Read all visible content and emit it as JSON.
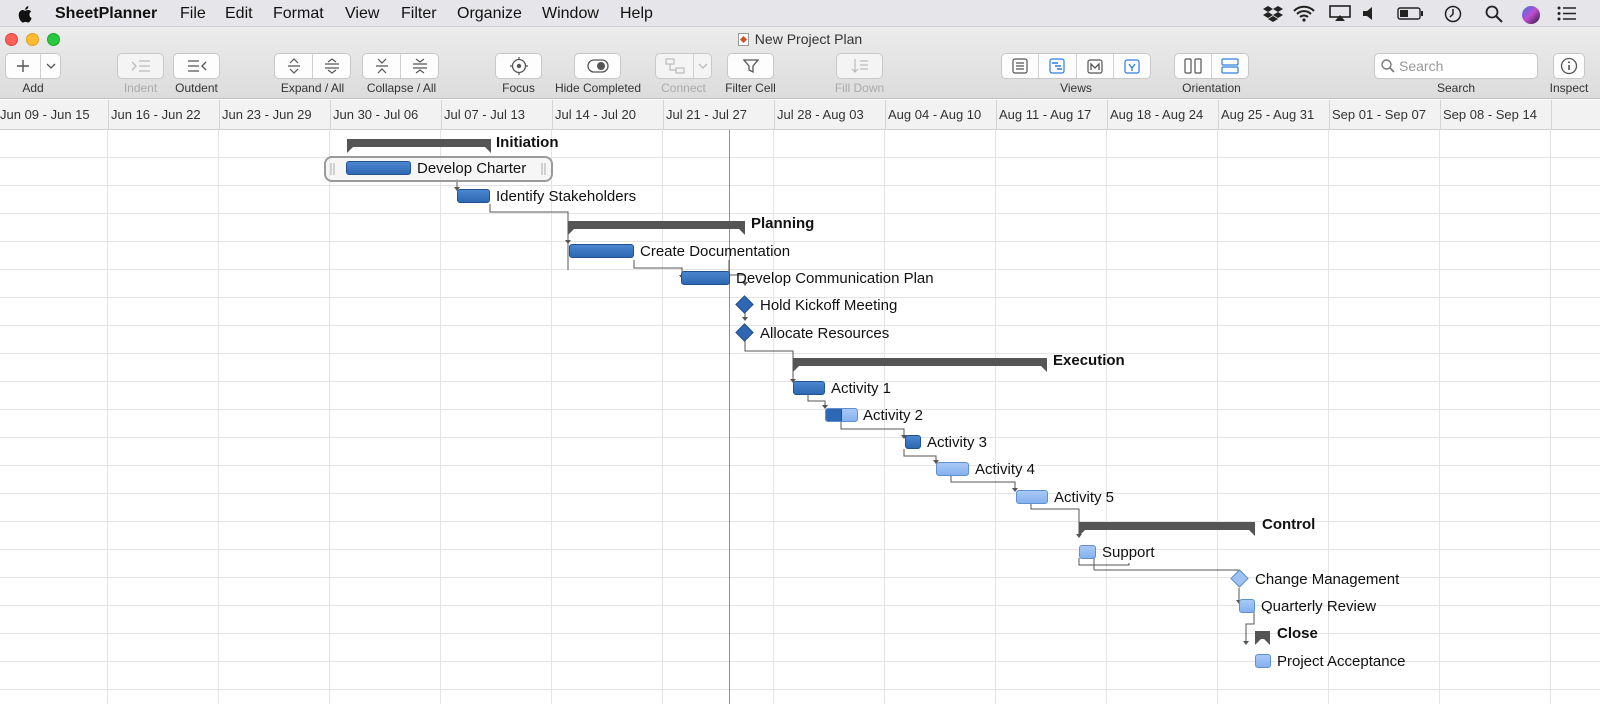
{
  "menubar": {
    "app_name": "SheetPlanner",
    "items": [
      "File",
      "Edit",
      "Format",
      "View",
      "Filter",
      "Organize",
      "Window",
      "Help"
    ]
  },
  "window": {
    "title": "New Project Plan"
  },
  "toolbar": {
    "add": "Add",
    "indent": "Indent",
    "outdent": "Outdent",
    "expand": "Expand / All",
    "collapse": "Collapse / All",
    "focus": "Focus",
    "hide_completed": "Hide Completed",
    "connect": "Connect",
    "filter_cell": "Filter Cell",
    "fill_down": "Fill Down",
    "views": "Views",
    "orientation": "Orientation",
    "search": "Search",
    "search_placeholder": "Search",
    "inspect": "Inspect"
  },
  "timeline": {
    "weeks": [
      "Jun 09 - Jun 15",
      "Jun 16 - Jun 22",
      "Jun 23 - Jun 29",
      "Jun 30 - Jul 06",
      "Jul 07 - Jul 13",
      "Jul 14 - Jul 20",
      "Jul 21 - Jul 27",
      "Jul 28 - Aug 03",
      "Aug 04 - Aug 10",
      "Aug 11 - Aug 17",
      "Aug 18 - Aug 24",
      "Aug 25 - Aug 31",
      "Sep 01 - Sep 07",
      "Sep 08 - Sep 14"
    ]
  },
  "tasks": [
    {
      "name": "Initiation",
      "kind": "group"
    },
    {
      "name": "Develop Charter",
      "kind": "task",
      "selected": true
    },
    {
      "name": "Identify Stakeholders",
      "kind": "task"
    },
    {
      "name": "Planning",
      "kind": "group"
    },
    {
      "name": "Create Documentation",
      "kind": "task"
    },
    {
      "name": "Develop Communication Plan",
      "kind": "task"
    },
    {
      "name": "Hold Kickoff Meeting",
      "kind": "milestone"
    },
    {
      "name": "Allocate Resources",
      "kind": "milestone"
    },
    {
      "name": "Execution",
      "kind": "group"
    },
    {
      "name": "Activity 1",
      "kind": "task"
    },
    {
      "name": "Activity 2",
      "kind": "task",
      "progress": 0.5
    },
    {
      "name": "Activity 3",
      "kind": "task"
    },
    {
      "name": "Activity 4",
      "kind": "task",
      "progress": 0
    },
    {
      "name": "Activity 5",
      "kind": "task",
      "progress": 0
    },
    {
      "name": "Control",
      "kind": "group"
    },
    {
      "name": "Support",
      "kind": "task",
      "progress": 0
    },
    {
      "name": "Change Management",
      "kind": "milestone",
      "progress": 0
    },
    {
      "name": "Quarterly Review",
      "kind": "task",
      "progress": 0
    },
    {
      "name": "Close",
      "kind": "group"
    },
    {
      "name": "Project Acceptance",
      "kind": "task",
      "progress": 0
    }
  ],
  "colors": {
    "accent": "#2f7fe0",
    "task_done": "#2e67b3",
    "task_pending": "#8fb8f0",
    "today_line": "#ef6a6a"
  }
}
